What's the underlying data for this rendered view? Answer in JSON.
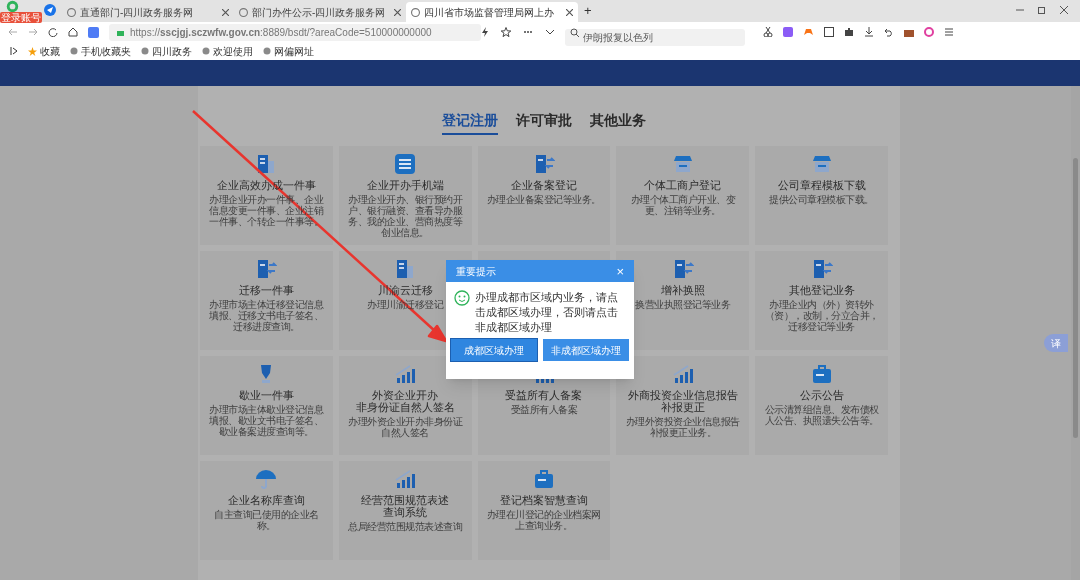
{
  "browser": {
    "account_badge": "登录账号",
    "tabs": [
      {
        "title": "直通部门-四川政务服务网",
        "selected": false
      },
      {
        "title": "部门办件公示-四川政务服务网",
        "selected": false
      },
      {
        "title": "四川省市场监督管理局网上办",
        "selected": true
      }
    ],
    "new_tab": "+",
    "address": "https://**sscjgj.sczwfw.gov.cn**:8889/bsdt/?areaCode=510000000000",
    "search": {
      "placeholder": "伊朗报复以色列"
    },
    "bookmarks": [
      "收藏",
      "手机收藏夹",
      "四川政务",
      "欢迎使用",
      "网偏网址"
    ]
  },
  "section_tabs": [
    {
      "label": "登记注册",
      "selected": true
    },
    {
      "label": "许可审批",
      "selected": false
    },
    {
      "label": "其他业务",
      "selected": false
    }
  ],
  "cards": [
    {
      "kind": "service",
      "title_lines": [
        "企业高效办成一件事"
      ],
      "description": "办理企业开办一件事、企业信息变更一件事、企业注销一件事、个转企一件事等。"
    },
    {
      "kind": "service",
      "title_lines": [
        "企业开办手机端"
      ],
      "description": "办理企业开办、银行预约开户、银行融资、查看导办服务、我的企业、营商热度等创业信息。"
    },
    {
      "kind": "service",
      "title_lines": [
        "企业备案登记"
      ],
      "description": "办理企业备案登记等业务。"
    },
    {
      "kind": "service",
      "title_lines": [
        "个体工商户登记"
      ],
      "description": "办理个体工商户开业、变更、注销等业务。"
    },
    {
      "kind": "service",
      "title_lines": [
        "公司章程模板下载"
      ],
      "description": "提供公司章程模板下载。"
    },
    {
      "kind": "service",
      "title_lines": [
        "迁移一件事"
      ],
      "description": "办理市场主体迁移登记信息填报、迁移文书电子签名、迁移进度查询。"
    },
    {
      "kind": "service",
      "title_lines": [
        "川渝云迁移"
      ],
      "description": "办理川渝迁移登记"
    },
    {
      "kind": "covered"
    },
    {
      "kind": "service",
      "title_lines": [
        "增补换照"
      ],
      "description": "换营业执照登记等业务"
    },
    {
      "kind": "service",
      "title_lines": [
        "其他登记业务"
      ],
      "description": "办理企业内（外）资转外（资），改制，分立合并，迁移登记等业务"
    },
    {
      "kind": "service",
      "title_lines": [
        "歇业一件事"
      ],
      "description": "办理市场主体歇业登记信息填报、歇业文书电子签名、歇业备案进度查询等。"
    },
    {
      "kind": "service",
      "title_lines": [
        "外资企业开办",
        "非身份证自然人签名"
      ],
      "description": "办理外资企业开办非身份证自然人签名"
    },
    {
      "kind": "service",
      "title_lines": [
        "受益所有人备案"
      ],
      "description": "受益所有人备案"
    },
    {
      "kind": "service",
      "title_lines": [
        "外商投资企业信息报告",
        "补报更正"
      ],
      "description": "办理外资投资企业信息报告补报更正业务。"
    },
    {
      "kind": "service",
      "title_lines": [
        "公示公告"
      ],
      "description": "公示清算组信息、发布债权人公告、执照遗失公告等。"
    },
    {
      "kind": "service",
      "title_lines": [
        "企业名称库查询"
      ],
      "description": "自主查询已使用的企业名称。"
    },
    {
      "kind": "service",
      "title_lines": [
        "经营范围规范表述",
        "查询系统"
      ],
      "description": "总局经营范围规范表述查询"
    },
    {
      "kind": "service",
      "title_lines": [
        "登记档案智慧查询"
      ],
      "description": "办理在川登记的企业档案网上查询业务。"
    }
  ],
  "dialog": {
    "title": "重要提示",
    "close": "×",
    "message": "办理成都市区域内业务，请点击成都区域办理，否则请点击非成都区域办理",
    "buttons": [
      {
        "label": "成都区域办理",
        "selected": true
      },
      {
        "label": "非成都区域办理",
        "selected": false
      }
    ]
  },
  "translate_button": "译"
}
